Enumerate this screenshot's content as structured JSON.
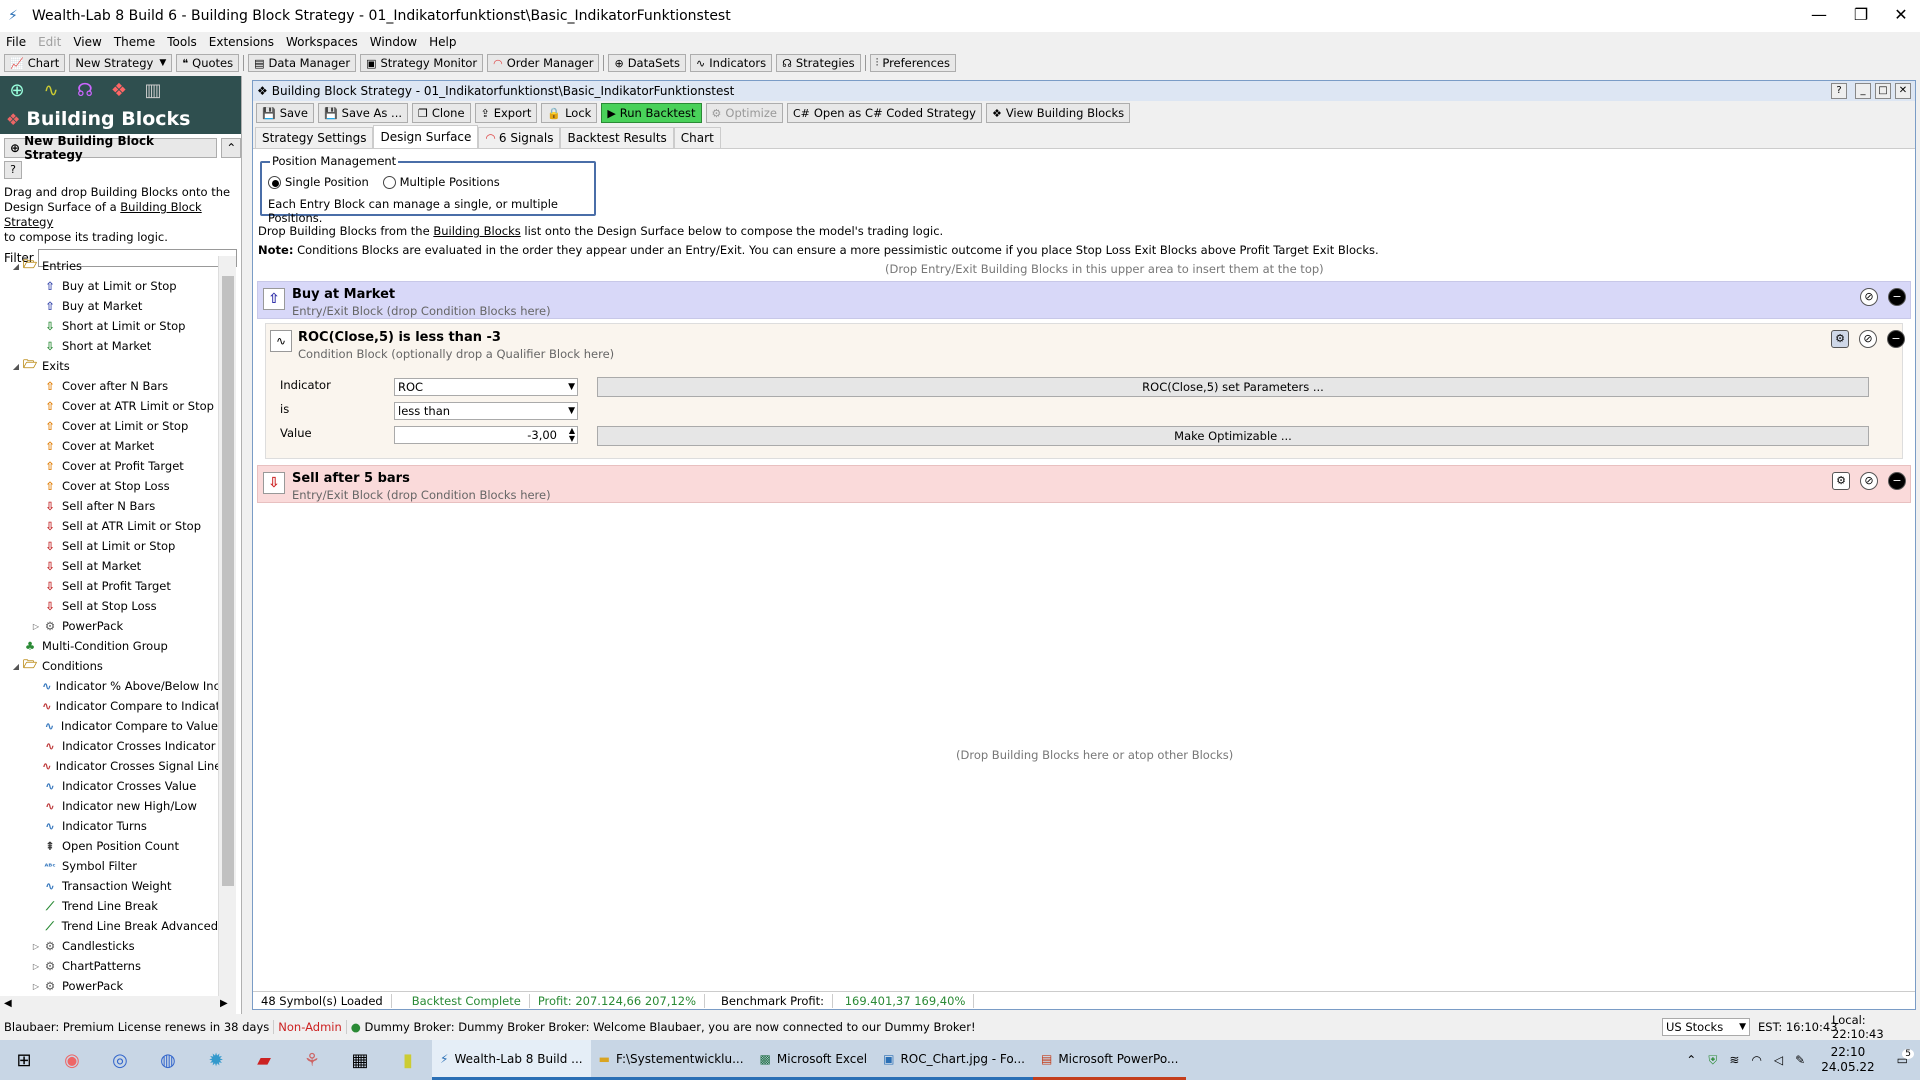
{
  "window": {
    "title": "Wealth-Lab 8 Build 6 - Building Block Strategy - 01_Indikatorfunktionst\\Basic_IndikatorFunktionstest"
  },
  "menu": [
    "File",
    "Edit",
    "View",
    "Theme",
    "Tools",
    "Extensions",
    "Workspaces",
    "Window",
    "Help"
  ],
  "menu_disabled": [
    "Edit"
  ],
  "toolbar": {
    "chart": "Chart",
    "new_strategy": "New Strategy",
    "quotes": "Quotes",
    "data_manager": "Data Manager",
    "strategy_monitor": "Strategy Monitor",
    "order_manager": "Order Manager",
    "datasets": "DataSets",
    "indicators": "Indicators",
    "strategies": "Strategies",
    "preferences": "Preferences"
  },
  "left": {
    "header": "Building Blocks",
    "new_button": "New Building Block Strategy",
    "help": "?",
    "desc_1": "Drag and drop Building Blocks onto the",
    "desc_2a": "Design Surface of a ",
    "desc_2b": "Building Block Strategy",
    "desc_3": "to compose its trading logic.",
    "filter_label": "Filter",
    "tree": [
      {
        "label": "Entries",
        "level": 0,
        "toggle": "◢",
        "icon": "folder"
      },
      {
        "label": "Buy at Limit or Stop",
        "level": 1,
        "icon": "up"
      },
      {
        "label": "Buy at Market",
        "level": 1,
        "icon": "up"
      },
      {
        "label": "Short at Limit or Stop",
        "level": 1,
        "icon": "downg"
      },
      {
        "label": "Short at Market",
        "level": 1,
        "icon": "downg"
      },
      {
        "label": "Exits",
        "level": 0,
        "toggle": "◢",
        "icon": "folder"
      },
      {
        "label": "Cover after N Bars",
        "level": 1,
        "icon": "upo"
      },
      {
        "label": "Cover at ATR Limit or Stop",
        "level": 1,
        "icon": "upo"
      },
      {
        "label": "Cover at Limit or Stop",
        "level": 1,
        "icon": "upo"
      },
      {
        "label": "Cover at Market",
        "level": 1,
        "icon": "upo"
      },
      {
        "label": "Cover at Profit Target",
        "level": 1,
        "icon": "upo"
      },
      {
        "label": "Cover at Stop Loss",
        "level": 1,
        "icon": "upo"
      },
      {
        "label": "Sell after N Bars",
        "level": 1,
        "icon": "downr"
      },
      {
        "label": "Sell at ATR Limit or Stop",
        "level": 1,
        "icon": "downr"
      },
      {
        "label": "Sell at Limit or Stop",
        "level": 1,
        "icon": "downr"
      },
      {
        "label": "Sell at Market",
        "level": 1,
        "icon": "downr"
      },
      {
        "label": "Sell at Profit Target",
        "level": 1,
        "icon": "downr"
      },
      {
        "label": "Sell at Stop Loss",
        "level": 1,
        "icon": "downr"
      },
      {
        "label": "PowerPack",
        "level": 1,
        "toggle": "▷",
        "icon": "gear"
      },
      {
        "label": "Multi-Condition Group",
        "level": 0,
        "icon": "group"
      },
      {
        "label": "Conditions",
        "level": 0,
        "toggle": "◢",
        "icon": "folder"
      },
      {
        "label": "Indicator % Above/Below Inc",
        "level": 1,
        "icon": "wave"
      },
      {
        "label": "Indicator Compare to Indicat",
        "level": 1,
        "icon": "wave2"
      },
      {
        "label": "Indicator Compare to Value",
        "level": 1,
        "icon": "wave"
      },
      {
        "label": "Indicator Crosses Indicator",
        "level": 1,
        "icon": "wave2"
      },
      {
        "label": "Indicator Crosses Signal Line",
        "level": 1,
        "icon": "wave2"
      },
      {
        "label": "Indicator Crosses Value",
        "level": 1,
        "icon": "wave"
      },
      {
        "label": "Indicator new High/Low",
        "level": 1,
        "icon": "wave2"
      },
      {
        "label": "Indicator Turns",
        "level": 1,
        "icon": "wave"
      },
      {
        "label": "Open Position Count",
        "level": 1,
        "icon": "count"
      },
      {
        "label": "Symbol Filter",
        "level": 1,
        "icon": "abc"
      },
      {
        "label": "Transaction Weight",
        "level": 1,
        "icon": "wave"
      },
      {
        "label": "Trend Line Break",
        "level": 1,
        "icon": "trend"
      },
      {
        "label": "Trend Line Break Advanced",
        "level": 1,
        "icon": "trend"
      },
      {
        "label": "Candlesticks",
        "level": 1,
        "toggle": "▷",
        "icon": "gear"
      },
      {
        "label": "ChartPatterns",
        "level": 1,
        "toggle": "▷",
        "icon": "gear"
      },
      {
        "label": "PowerPack",
        "level": 1,
        "toggle": "▷",
        "icon": "gear"
      }
    ]
  },
  "doc": {
    "title": "Building Block Strategy - 01_Indikatorfunktionst\\Basic_IndikatorFunktionstest",
    "help": "?",
    "buttons": {
      "save": "Save",
      "save_as": "Save As ...",
      "clone": "Clone",
      "export": "Export",
      "lock": "Lock",
      "run": "Run Backtest",
      "optimize": "Optimize",
      "open_cs": "Open as C# Coded Strategy",
      "view_blocks": "View Building Blocks"
    },
    "tabs": [
      "Strategy Settings",
      "Design Surface",
      "6 Signals",
      "Backtest Results",
      "Chart"
    ],
    "active_tab": "Design Surface"
  },
  "design": {
    "pos_legend": "Position Management",
    "single": "Single Position",
    "multiple": "Multiple Positions",
    "pos_note": "Each Entry Block can manage a single, or multiple Positions.",
    "info1a": "Drop Building Blocks from the ",
    "info1b": "Building Blocks",
    "info1c": " list onto the Design Surface below to compose the model's trading logic.",
    "info2a": "Note:",
    "info2b": " Conditions Blocks are evaluated in the order they appear under an Entry/Exit. You can ensure a more pessimistic outcome if you place Stop Loss Exit Blocks above Profit Target Exit Blocks.",
    "top_hint": "(Drop Entry/Exit Building Blocks in this upper area to insert them at the top)",
    "buy_title": "Buy at Market",
    "buy_sub": "Entry/Exit Block (drop Condition Blocks here)",
    "cond_title": "ROC(Close,5) is less than -3",
    "cond_sub": "Condition Block (optionally drop a Qualifier Block here)",
    "indicator_label": "Indicator",
    "indicator_value": "ROC",
    "is_label": "is",
    "is_value": "less than",
    "value_label": "Value",
    "value_value": "-3,00",
    "params_btn": "ROC(Close,5) set Parameters ...",
    "optimizable_btn": "Make Optimizable ...",
    "sell_title": "Sell after 5 bars",
    "sell_sub": "Entry/Exit Block (drop Condition Blocks here)",
    "bottom_hint": "(Drop Building Blocks here or atop other Blocks)"
  },
  "status": {
    "symbols": "48 Symbol(s) Loaded",
    "backtest": "Backtest Complete",
    "profit": "Profit: 207.124,66 207,12%",
    "benchmark_label": "Benchmark Profit:",
    "benchmark_value": "169.401,37 169,40%"
  },
  "appstatus": {
    "license": "Blaubaer: Premium License renews in 38 days",
    "admin": "Non-Admin",
    "broker": "Dummy Broker: Dummy Broker Broker: Welcome Blaubaer, you are now connected to our Dummy Broker!",
    "market": "US Stocks",
    "est": "EST: 16:10:43",
    "local": "Local: 22:10:43"
  },
  "taskbar": {
    "apps": [
      "Wealth-Lab 8 Build ...",
      "F:\\Systementwicklu...",
      "Microsoft Excel",
      "ROC_Chart.jpg - Fo...",
      "Microsoft PowerPo..."
    ],
    "time": "22:10",
    "date": "24.05.22",
    "notif": "5"
  },
  "colors": {
    "buy_bg": "#d8d8f8",
    "sell_bg": "#fadada",
    "run_btn": "#49d15a",
    "sidebar_head": "#2f4f4f"
  }
}
